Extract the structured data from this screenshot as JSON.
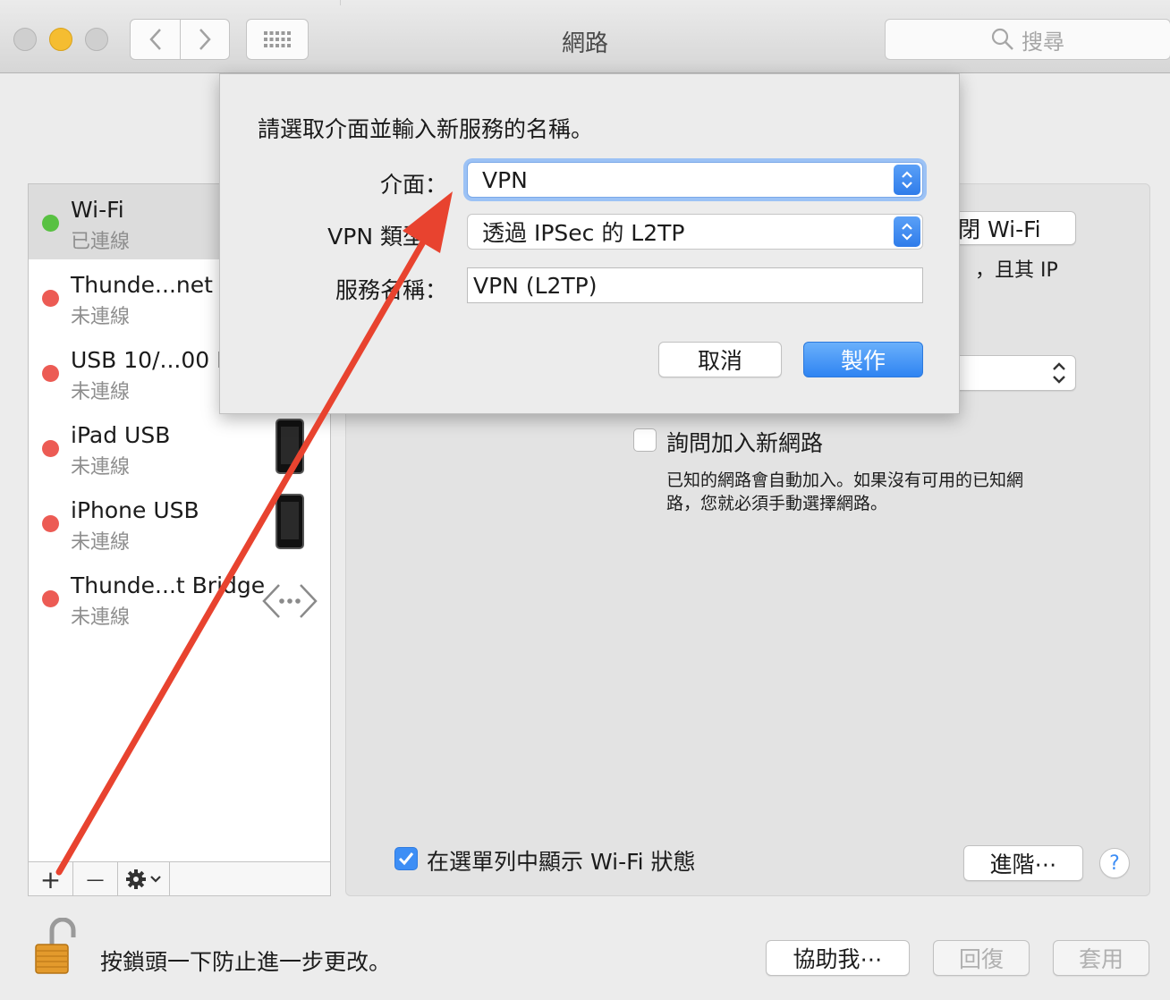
{
  "window": {
    "title": "網路"
  },
  "search": {
    "placeholder": "搜尋"
  },
  "services": [
    {
      "name": "Wi-Fi",
      "status": "已連線",
      "dot": "#58c142"
    },
    {
      "name": "Thunde...net S",
      "status": "未連線",
      "dot": "#ec5b54"
    },
    {
      "name": "USB 10/...00 L",
      "status": "未連線",
      "dot": "#ec5b54"
    },
    {
      "name": "iPad USB",
      "status": "未連線",
      "dot": "#ec5b54"
    },
    {
      "name": "iPhone USB",
      "status": "未連線",
      "dot": "#ec5b54"
    },
    {
      "name": "Thunde...t Bridge",
      "status": "未連線",
      "dot": "#ec5b54"
    }
  ],
  "sidebar_toolbar": {
    "add": "+",
    "remove": "—"
  },
  "main": {
    "wifi_button": "閉 Wi-Fi",
    "partial_text": "，且其 IP",
    "ask_join_label": "詢問加入新網路",
    "ask_join_desc_1": "已知的網路會自動加入。如果沒有可用的已知網",
    "ask_join_desc_2": "路，您就必須手動選擇網路。",
    "show_wifi_status_label": "在選單列中顯示 Wi-Fi 狀態",
    "advanced_button": "進階⋯",
    "help_button": "?"
  },
  "footer": {
    "lock_text": "按鎖頭一下防止進一步更改。",
    "assist_button": "協助我⋯",
    "revert_button": "回復",
    "apply_button": "套用"
  },
  "dialog": {
    "prompt": "請選取介面並輸入新服務的名稱。",
    "interface_label": "介面：",
    "interface_value": "VPN",
    "vpn_type_label": "VPN 類型：",
    "vpn_type_value": "透過 IPSec 的 L2TP",
    "service_name_label": "服務名稱：",
    "service_name_value": "VPN (L2TP)",
    "cancel_button": "取消",
    "create_button": "製作"
  },
  "colors": {
    "accent": "#3d8ef5",
    "annotation_arrow": "#e8432f"
  }
}
